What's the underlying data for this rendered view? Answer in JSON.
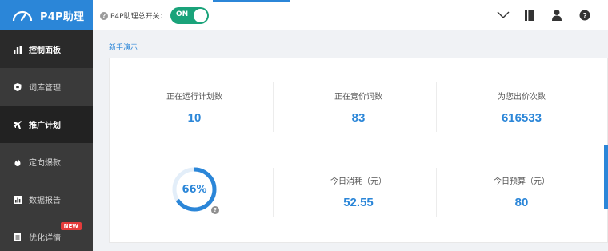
{
  "app": {
    "title": "P4P助理"
  },
  "topbar": {
    "switch_label": "P4P助理总开关：",
    "toggle_state": "ON",
    "icons": [
      "chevron-down-icon",
      "book-icon",
      "user-icon",
      "help-icon"
    ]
  },
  "sidebar": {
    "items": [
      {
        "label": "控制面板",
        "icon": "bar-chart-icon"
      },
      {
        "label": "词库管理",
        "icon": "shield-icon"
      },
      {
        "label": "推广计划",
        "icon": "rocket-icon"
      },
      {
        "label": "定向爆款",
        "icon": "fire-icon"
      },
      {
        "label": "数据报告",
        "icon": "report-icon"
      },
      {
        "label": "优化详情",
        "icon": "document-icon",
        "badge": "NEW"
      }
    ]
  },
  "breadcrumb": {
    "link": "新手演示"
  },
  "stats": {
    "running_plans_label": "正在运行计划数",
    "running_plans_value": "10",
    "bidding_words_label": "正在竞价词数",
    "bidding_words_value": "83",
    "bid_times_label": "为您出价次数",
    "bid_times_value": "616533",
    "today_cost_label": "今日消耗（元）",
    "today_cost_value": "52.55",
    "today_budget_label": "今日预算（元）",
    "today_budget_value": "80"
  },
  "progress": {
    "label": "66%",
    "fraction": 0.66
  },
  "colors": {
    "accent": "#2b86d8",
    "sidebar": "#3a3a3a",
    "toggle_on": "#1aa37a",
    "badge": "#e43b3b"
  }
}
